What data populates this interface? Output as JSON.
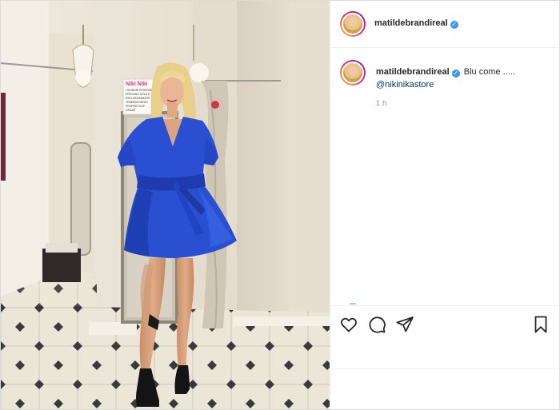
{
  "post": {
    "author": {
      "username": "matildebrandireal",
      "verified": true
    },
    "caption": {
      "username": "matildebrandireal",
      "text": "Blu come .....",
      "mention": "@nikinikastore"
    },
    "timestamp": "1 h",
    "photo": {
      "description_icons": "woman-in-blue-dress",
      "sign_lines": [
        "Niki Niki",
        "I SIGNORI PERSONE",
        "PREGANO SOLO E",
        "ESCLUSIVAMENTE",
        "TENENDO MENO",
        "PROPRIO SLIP",
        "GRAZIE"
      ]
    },
    "actions": {
      "like": "heart-icon",
      "comment": "comment-icon",
      "share": "paper-plane-icon",
      "save": "bookmark-icon"
    }
  },
  "colors": {
    "verified": "#3897f0",
    "mention": "#00376b",
    "dress": "#2a4fd0",
    "border": "#dbdbdb"
  }
}
